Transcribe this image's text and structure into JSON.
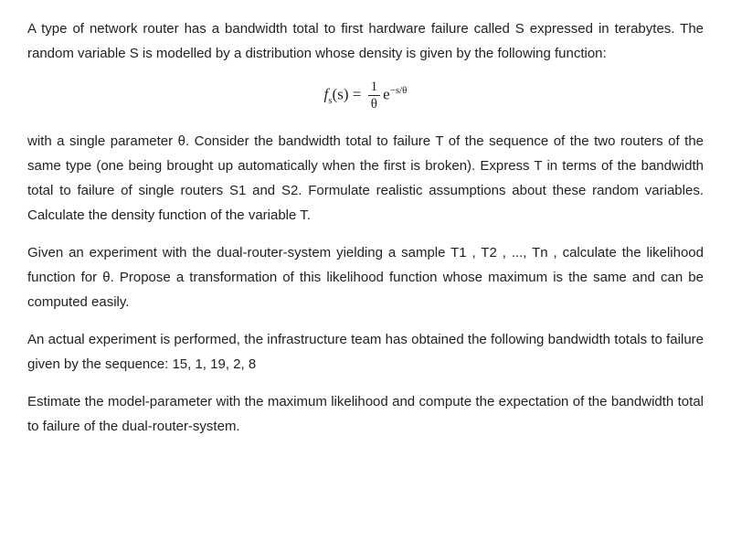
{
  "p1": "A type of network router has a bandwidth total to first hardware failure called S expressed in terabytes. The random variable S is modelled by a distribution whose density is given by the following function:",
  "formula": {
    "lhs_f": "f",
    "lhs_sub": "s",
    "lhs_arg": "(s)",
    "eq": " = ",
    "frac_num": "1",
    "frac_den": "θ",
    "e": "e",
    "exp": "−s/θ"
  },
  "p2": "with a single parameter θ. Consider the bandwidth total to failure T of the sequence of the two routers of the same type (one being brought up automatically when the first is broken). Express T in terms of the bandwidth total to failure of single routers S1 and S2. Formulate realistic assumptions about these random variables. Calculate the density function of the variable T.",
  "p3": "Given an experiment with the dual-router-system yielding a sample T1 , T2 , ..., Tn , calculate the likelihood function for θ.  Propose a transformation of this likelihood function whose maximum is the same and can be computed easily.",
  "p4": "An actual experiment is performed, the infrastructure team has obtained the following bandwidth totals to failure given by the sequence: 15, 1, 19, 2, 8",
  "p5": "Estimate the model-parameter with the maximum likelihood and compute the expectation of the bandwidth total to failure of the dual-router-system.",
  "data_sequence": [
    15,
    1,
    19,
    2,
    8
  ]
}
